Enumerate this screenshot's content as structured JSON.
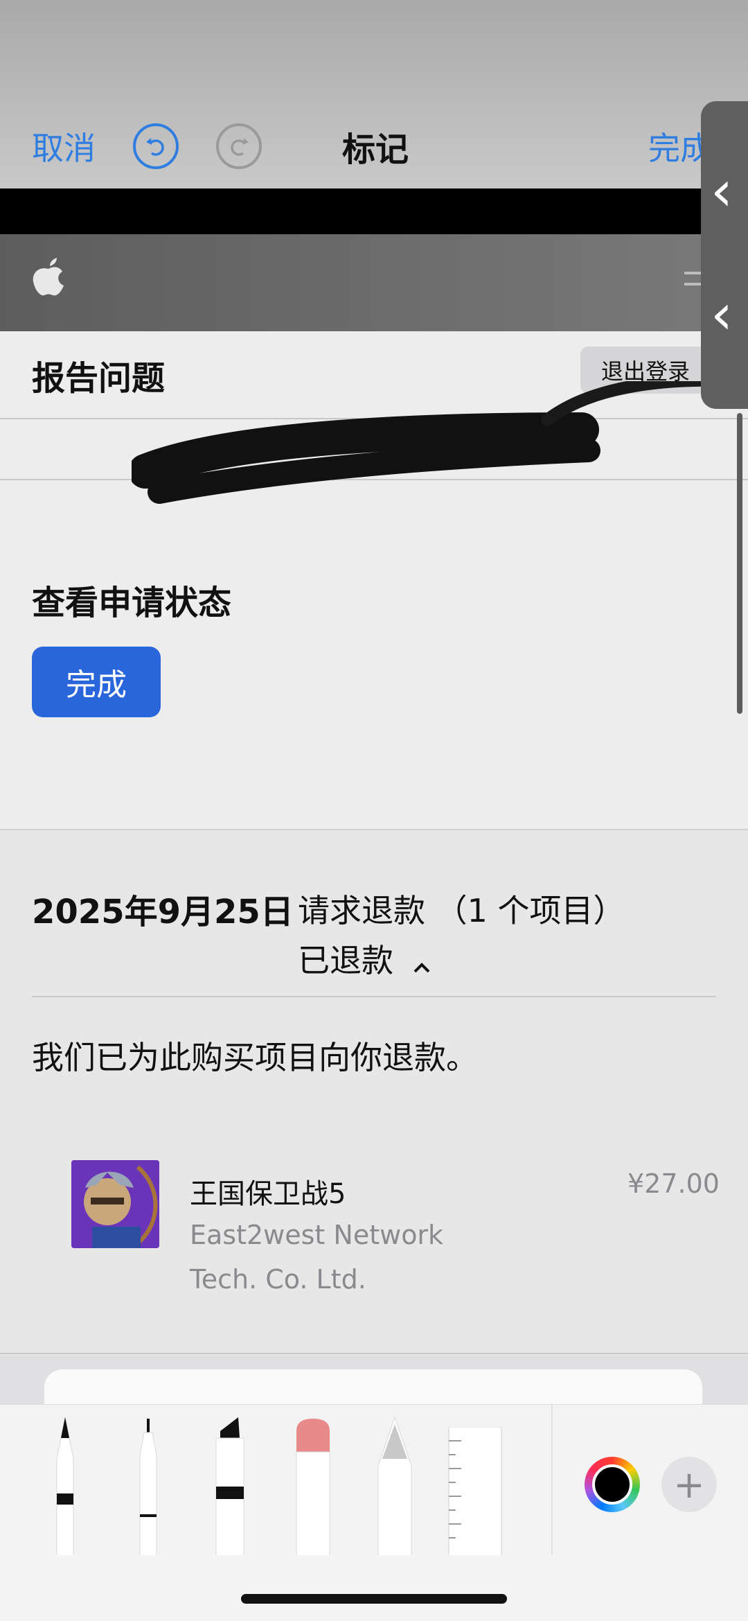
{
  "markup_toolbar": {
    "cancel_label": "取消",
    "title": "标记",
    "done_label": "完成"
  },
  "site_header": {
    "logo": "apple-logo",
    "menu_icon": "hamburger-icon"
  },
  "report": {
    "title": "报告问题",
    "logout_label": "退出登录"
  },
  "status": {
    "title": "查看申请状态",
    "done_button_label": "完成"
  },
  "purchase": {
    "date": "2025年9月25日",
    "request": "请求退款 （1 个项目）",
    "status": "已退款",
    "message": "我们已为此购买项目向你退款。",
    "item": {
      "name": "王国保卫战5",
      "developer_line1": "East2west Network",
      "developer_line2": "Tech. Co. Ltd.",
      "price": "¥27.00"
    }
  },
  "palette": {
    "tools": [
      "pen",
      "fineliner",
      "marker",
      "eraser",
      "pencil",
      "ruler"
    ],
    "selected_color": "#000000",
    "accent": "#2f7de1"
  }
}
